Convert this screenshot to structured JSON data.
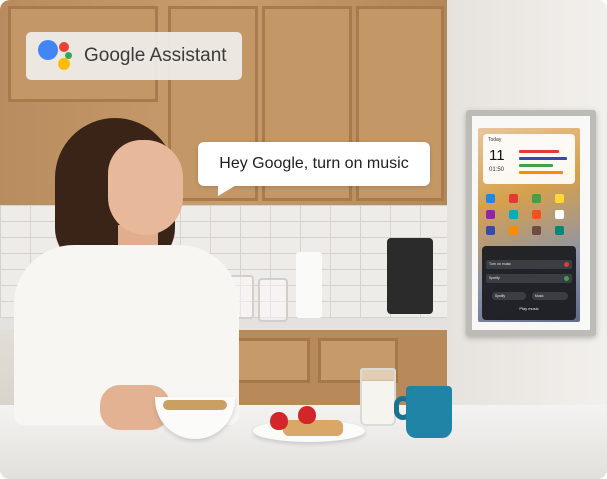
{
  "badge": {
    "label": "Google Assistant",
    "logo_colors": [
      "#4285F4",
      "#EA4335",
      "#FBBC05",
      "#34A853"
    ]
  },
  "speech_bubble": {
    "text": "Hey Google, turn on music"
  },
  "device_screen": {
    "widget": {
      "header": "Today",
      "day": "11",
      "time": "01:50"
    },
    "panel": {
      "rows": [
        {
          "label": "Turn on music",
          "status_color": "#E53935"
        },
        {
          "label": "Spotify",
          "status_color": "#43A047"
        }
      ],
      "chips": [
        "Spotify",
        "Music"
      ],
      "command": "Play music"
    }
  },
  "colors": {
    "accent_blue": "#4285F4",
    "mug": "#1F84A6",
    "cabinet": "#C49766"
  }
}
